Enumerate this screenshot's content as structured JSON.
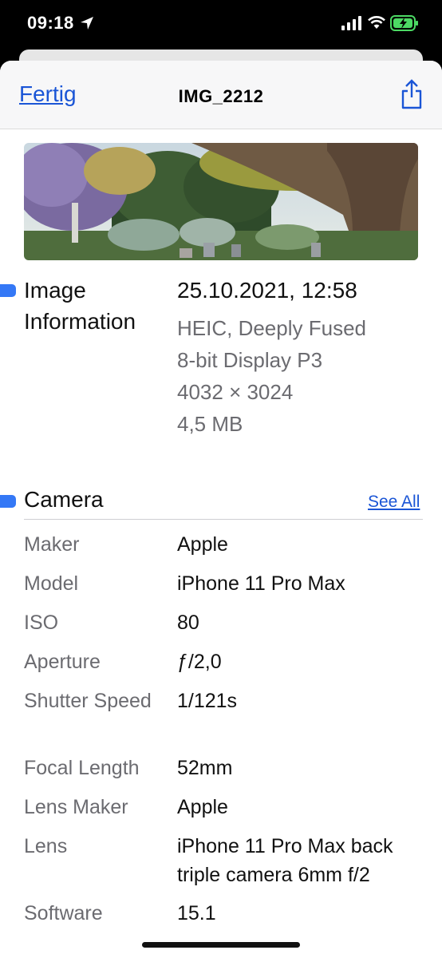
{
  "status": {
    "time": "09:18"
  },
  "nav": {
    "done_label": "Fertig",
    "title": "IMG_2212"
  },
  "image_info": {
    "heading": "Image\nInformation",
    "datetime": "25.10.2021, 12:58",
    "format": "HEIC, Deeply Fused",
    "color": "8-bit Display P3",
    "dimensions": "4032 × 3024",
    "size": "4,5 MB"
  },
  "camera": {
    "heading": "Camera",
    "see_all": "See All",
    "rows": [
      {
        "label": "Maker",
        "value": "Apple"
      },
      {
        "label": "Model",
        "value": "iPhone 11 Pro Max"
      },
      {
        "label": "ISO",
        "value": "80"
      },
      {
        "label": "Aperture",
        "value": "ƒ/2,0"
      },
      {
        "label": "Shutter Speed",
        "value": "1/121s"
      },
      {
        "label": "Focal Length",
        "value": "52mm"
      },
      {
        "label": "Lens Maker",
        "value": "Apple"
      },
      {
        "label": "Lens",
        "value": "iPhone 11 Pro Max back triple camera 6mm f/2"
      },
      {
        "label": "Software",
        "value": "15.1"
      }
    ]
  },
  "colors": {
    "accent": "#1a55d6",
    "marker": "#3478f6"
  }
}
